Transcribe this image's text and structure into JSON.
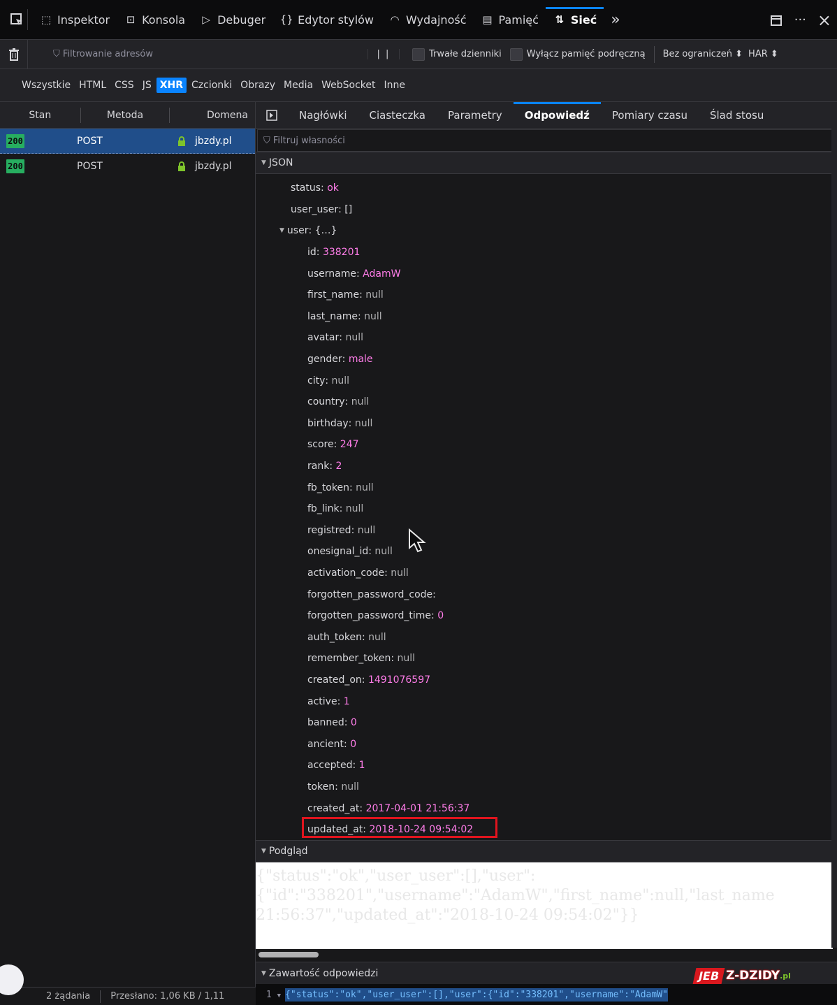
{
  "toolbar": {
    "tabs": [
      {
        "label": "Inspektor",
        "icon": "inspector-icon"
      },
      {
        "label": "Konsola",
        "icon": "console-icon"
      },
      {
        "label": "Debuger",
        "icon": "debugger-icon"
      },
      {
        "label": "Edytor stylów",
        "icon": "style-editor-icon"
      },
      {
        "label": "Wydajność",
        "icon": "performance-icon"
      },
      {
        "label": "Pamięć",
        "icon": "memory-icon"
      },
      {
        "label": "Sieć",
        "icon": "network-icon"
      }
    ],
    "overflow": "»",
    "more": "···",
    "close": "×"
  },
  "filterbar": {
    "url_filter_placeholder": "Filtrowanie adresów",
    "pause": "| |",
    "persist_logs": "Trwałe dzienniki",
    "disable_cache": "Wyłącz pamięć podręczną",
    "throttling": "Bez ograniczeń ⬍",
    "har": "HAR ⬍"
  },
  "typefilters": [
    "Wszystkie",
    "HTML",
    "CSS",
    "JS",
    "XHR",
    "Czcionki",
    "Obrazy",
    "Media",
    "WebSocket",
    "Inne"
  ],
  "requests": {
    "headers": {
      "status": "Stan",
      "method": "Metoda",
      "domain": "Domena"
    },
    "rows": [
      {
        "status": "200",
        "method": "POST",
        "domain": "jbzdy.pl"
      },
      {
        "status": "200",
        "method": "POST",
        "domain": "jbzdy.pl"
      }
    ]
  },
  "details": {
    "tabs": [
      "Nagłówki",
      "Ciasteczka",
      "Parametry",
      "Odpowiedź",
      "Pomiary czasu",
      "Ślad stosu"
    ],
    "prop_filter_placeholder": "Filtruj własności",
    "json_label": "JSON",
    "preview_label": "Podgląd",
    "content_label": "Zawartość odpowiedzi"
  },
  "json": {
    "status": {
      "key": "status",
      "value": "ok"
    },
    "user_user": {
      "key": "user_user",
      "value": "[]"
    },
    "user": {
      "key": "user",
      "value": "{…}"
    },
    "fields": [
      {
        "key": "id",
        "value": "338201",
        "kind": "num"
      },
      {
        "key": "username",
        "value": "AdamW",
        "kind": "str"
      },
      {
        "key": "first_name",
        "value": "null",
        "kind": "null"
      },
      {
        "key": "last_name",
        "value": "null",
        "kind": "null"
      },
      {
        "key": "avatar",
        "value": "null",
        "kind": "null"
      },
      {
        "key": "gender",
        "value": "male",
        "kind": "str"
      },
      {
        "key": "city",
        "value": "null",
        "kind": "null"
      },
      {
        "key": "country",
        "value": "null",
        "kind": "null"
      },
      {
        "key": "birthday",
        "value": "null",
        "kind": "null"
      },
      {
        "key": "score",
        "value": "247",
        "kind": "num"
      },
      {
        "key": "rank",
        "value": "2",
        "kind": "num"
      },
      {
        "key": "fb_token",
        "value": "null",
        "kind": "null"
      },
      {
        "key": "fb_link",
        "value": "null",
        "kind": "null"
      },
      {
        "key": "registred",
        "value": "null",
        "kind": "null"
      },
      {
        "key": "onesignal_id",
        "value": "null",
        "kind": "null"
      },
      {
        "key": "activation_code",
        "value": "null",
        "kind": "null"
      },
      {
        "key": "forgotten_password_code",
        "value": "",
        "kind": "str"
      },
      {
        "key": "forgotten_password_time",
        "value": "0",
        "kind": "num"
      },
      {
        "key": "auth_token",
        "value": "null",
        "kind": "null"
      },
      {
        "key": "remember_token",
        "value": "null",
        "kind": "null"
      },
      {
        "key": "created_on",
        "value": "1491076597",
        "kind": "num"
      },
      {
        "key": "active",
        "value": "1",
        "kind": "num"
      },
      {
        "key": "banned",
        "value": "0",
        "kind": "num"
      },
      {
        "key": "ancient",
        "value": "0",
        "kind": "num"
      },
      {
        "key": "accepted",
        "value": "1",
        "kind": "num"
      },
      {
        "key": "token",
        "value": "null",
        "kind": "null"
      },
      {
        "key": "created_at",
        "value": "2017-04-01 21:56:37",
        "kind": "str"
      },
      {
        "key": "updated_at",
        "value": "2018-10-24 09:54:02",
        "kind": "str"
      }
    ]
  },
  "preview": {
    "line1": "{\"status\":\"ok\",\"user_user\":[],\"user\":",
    "line2": "{\"id\":\"338201\",\"username\":\"AdamW\",\"first_name\":null,\"last_name",
    "line3": "21:56:37\",\"updated_at\":\"2018-10-24 09:54:02\"}}"
  },
  "raw": {
    "line_no": "1",
    "text": "{\"status\":\"ok\",\"user_user\":[],\"user\":{\"id\":\"338201\",\"username\":\"AdamW\""
  },
  "statusbar": {
    "requests": "2 żądania",
    "transferred": "Przesłano: 1,06 KB / 1,11"
  },
  "watermark": {
    "jeb": "JEB",
    "dzidy": "Z-DZIDY",
    "pl": ".pl"
  }
}
